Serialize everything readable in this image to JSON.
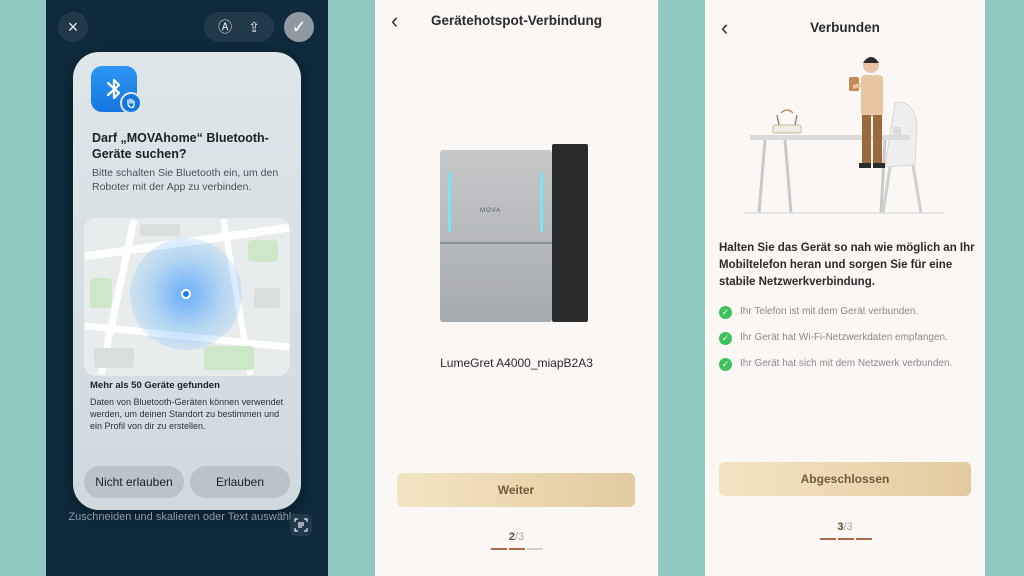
{
  "panel1": {
    "close_icon": "×",
    "pill_icons": [
      "Ⓐ",
      "⇪"
    ],
    "check_icon": "✓",
    "dialog": {
      "title": "Darf „MOVAhome“ Bluetooth-Geräte suchen?",
      "text": "Bitte schalten Sie Bluetooth ein, um den Roboter mit der App zu verbinden.",
      "found_title": "Mehr als 50 Geräte gefunden",
      "found_text": "Daten von Bluetooth-Geräten können verwendet werden, um deinen Standort zu bestimmen und ein Profil von dir zu erstellen.",
      "deny_label": "Nicht erlauben",
      "allow_label": "Erlauben"
    },
    "caption": "Zuschneiden und skalieren oder Text auswählen"
  },
  "panel2": {
    "back_icon": "‹",
    "title": "Gerätehotspot-Verbindung",
    "device_logo": "MOVA",
    "device_name": "LumeGret A4000_miapB2A3",
    "button_label": "Weiter",
    "step_current": "2",
    "step_total": "/3",
    "progress_steps_done": 2,
    "progress_steps_total": 3
  },
  "panel3": {
    "back_icon": "‹",
    "title": "Verbunden",
    "description": "Halten Sie das Gerät so nah wie möglich an Ihr Mobiltelefon heran und sorgen Sie für eine stabile Netzwerkverbindung.",
    "status_items": [
      "Ihr Telefon ist mit dem Gerät verbunden.",
      "Ihr Gerät hat Wi-Fi-Netzwerkdaten empfangen.",
      "Ihr Gerät hat sich mit dem Netzwerk verbunden."
    ],
    "button_label": "Abgeschlossen",
    "step_current": "3",
    "step_total": "/3",
    "progress_steps_done": 3,
    "progress_steps_total": 3
  },
  "colors": {
    "background": "#8fc9c1",
    "accent_gold": "#e2cba0",
    "success_green": "#3cc25a",
    "bluetooth_blue": "#1576e0"
  }
}
